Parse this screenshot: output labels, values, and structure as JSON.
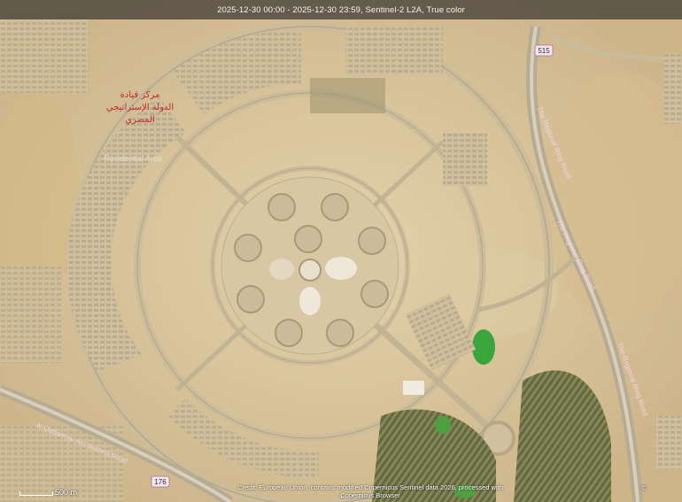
{
  "header": {
    "caption": "2025-12-30 00:00 - 2025-12-30 23:59, Sentinel-2 L2A, True color"
  },
  "labels": {
    "road_regional_ring_1": "The Regional Ring Road",
    "road_regional_ring_2": "The Regional Ring Road",
    "road_ain_sokhna": "Al Qattamya- Ain Sokhna Road",
    "district_arabic_line1": "مركز قيادة",
    "district_arabic_line2": "الدولة الإستراتيجي",
    "district_arabic_line3": "المصري",
    "area_residential": "Residential Area"
  },
  "shields": {
    "route_515": "515",
    "route_176": "176"
  },
  "scale": {
    "label": "500 m"
  },
  "footer": {
    "credit_line1": "Credit: European Union, contains modified Copernicus Sentinel data 2026, processed with",
    "credit_line2": "Copernicus Browser",
    "watermark": "©"
  },
  "colors": {
    "desert": "#d9c49a",
    "sand_light": "#e2cfa8",
    "road": "#cdbf9f",
    "road_edge": "#b8a684",
    "building": "#c6b89a",
    "green_field": "#3aa53a",
    "dark_crops": "#6b6a45",
    "road_label": "#f4d3e4",
    "district_label": "#c4282c"
  }
}
